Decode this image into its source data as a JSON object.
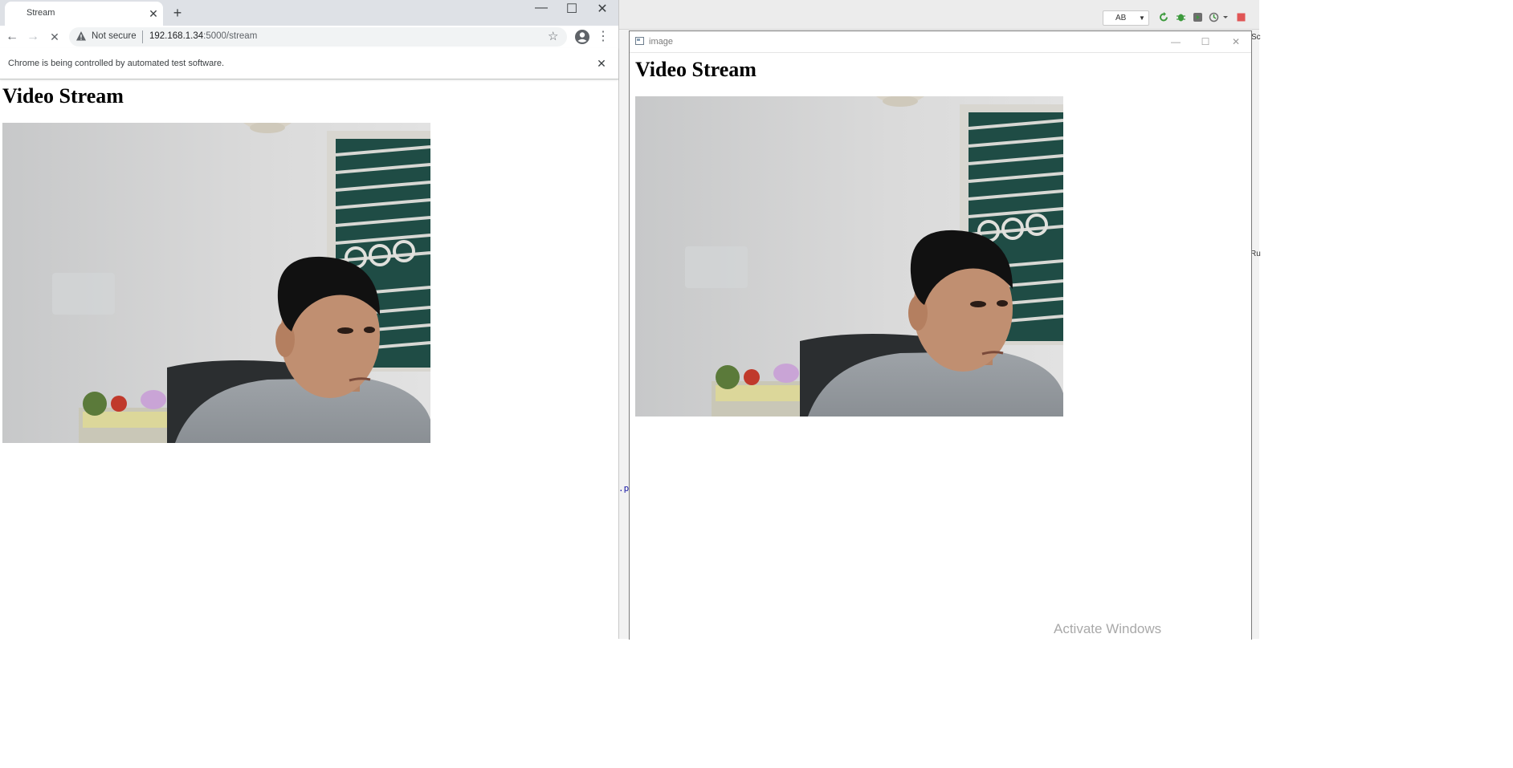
{
  "browser": {
    "tab": {
      "title": "Stream",
      "close_glyph": "✕"
    },
    "new_tab_glyph": "+",
    "window_controls": {
      "minimize": "—",
      "maximize": "☐",
      "close": "✕"
    },
    "nav": {
      "back": "←",
      "forward": "→",
      "stop": "✕"
    },
    "omnibox": {
      "security_label": "Not secure",
      "host": "192.168.1.34",
      "path": ":5000/stream",
      "star_glyph": "☆"
    },
    "menu_glyph": "⋮",
    "infobar": {
      "text": "Chrome is being controlled by automated test software.",
      "close_glyph": "✕"
    },
    "page": {
      "heading": "Video Stream"
    }
  },
  "image_window": {
    "title": "image",
    "controls": {
      "minimize": "—",
      "maximize": "☐",
      "close": "✕"
    },
    "heading": "Video Stream"
  },
  "ide": {
    "run_config_label": "AB",
    "dropdown_glyph": "▼",
    "side_label": "Ru",
    "side_label_top": "Sc",
    "code_fragment": ".p"
  },
  "os": {
    "watermark": "Activate Windows"
  },
  "icons": [
    "warning-icon",
    "star-icon",
    "profile-icon",
    "menu-icon",
    "image-window-icon",
    "ide-rerun-icon",
    "ide-debug-icon",
    "ide-coverage-icon",
    "ide-profile-icon",
    "ide-stop-icon"
  ],
  "colors": {
    "tabstrip": "#dee1e6",
    "omnibox": "#f1f3f4",
    "ide_stop": "#e05555",
    "ide_run": "#3c9a3c"
  }
}
